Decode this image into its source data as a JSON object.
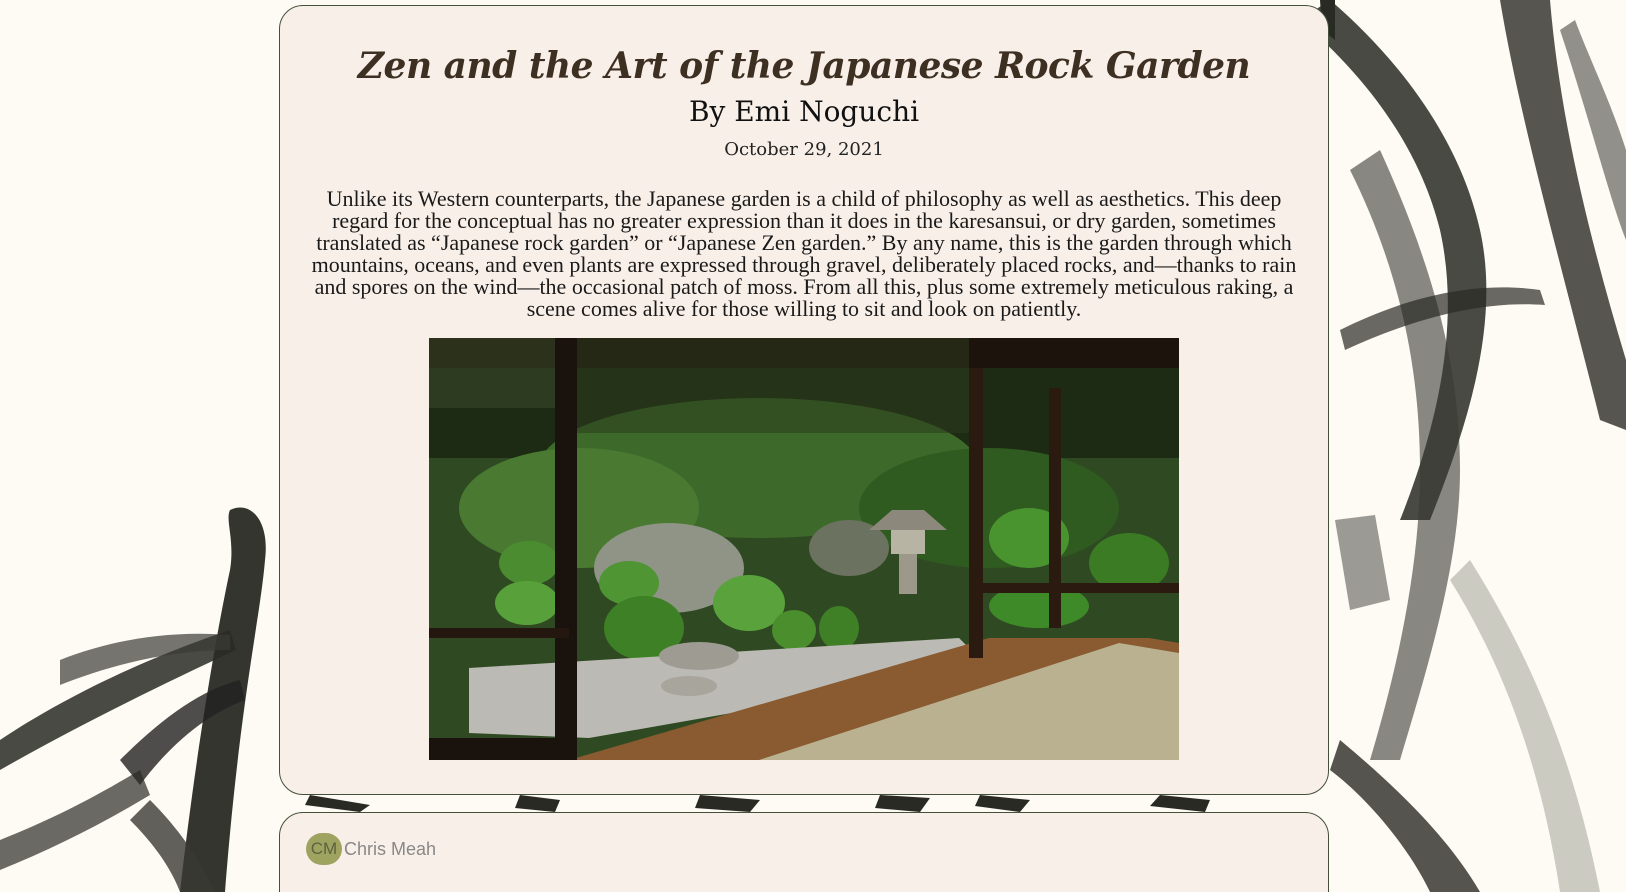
{
  "article": {
    "title": "Zen and the Art of the Japanese Rock Garden",
    "byline": "By Emi Noguchi",
    "date": "October 29, 2021",
    "body": "Unlike its Western counterparts, the Japanese garden is a child of philosophy as well as aesthetics. This deep regard for the conceptual has no greater expression than it does in the karesansui, or dry garden, sometimes translated as “Japanese rock garden” or “Japanese Zen garden.” By any name, this is the garden through which mountains, oceans, and even plants are expressed through gravel, deliberately placed rocks, and—thanks to rain and spores on the wind—the occasional patch of moss. From all this, plus some extremely meticulous raking, a scene comes alive for those willing to sit and look on patiently."
  },
  "comment": {
    "avatar_initials": "CM",
    "author": "Chris Meah"
  },
  "colors": {
    "card_background": "#f8efe8",
    "card_border": "#45503a",
    "title": "#3d2f22",
    "avatar": "#9ea460"
  }
}
